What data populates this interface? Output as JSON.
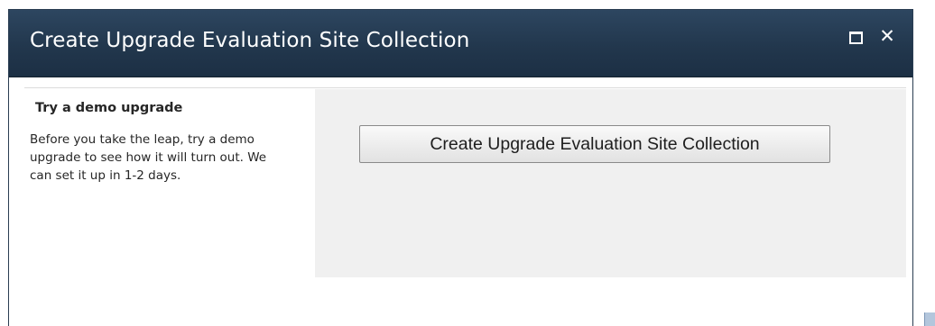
{
  "dialog": {
    "title": "Create Upgrade Evaluation Site Collection",
    "maximize_icon": "maximize-icon",
    "close_icon": "close-icon",
    "close_glyph": "✕"
  },
  "left_panel": {
    "heading": "Try a demo upgrade",
    "description": "Before you take the leap, try a demo upgrade to see how it will turn out. We can set it up in 1-2 days."
  },
  "right_panel": {
    "button_label": "Create Upgrade Evaluation Site Collection"
  },
  "colors": {
    "titlebar": "#22374d",
    "title_text": "#ffffff",
    "panel_background": "#f0f0f0",
    "body_text": "#262626"
  }
}
